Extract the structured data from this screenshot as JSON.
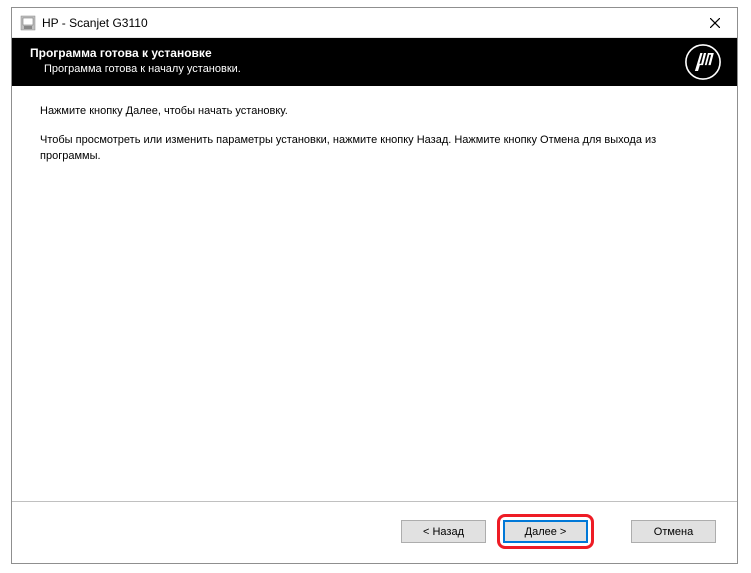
{
  "window": {
    "title": "HP - Scanjet G3110"
  },
  "header": {
    "title": "Программа готова к установке",
    "subtitle": "Программа готова к началу установки."
  },
  "content": {
    "line1": "Нажмите кнопку Далее, чтобы начать установку.",
    "line2": "Чтобы просмотреть или изменить параметры установки, нажмите кнопку Назад. Нажмите кнопку Отмена для выхода из программы."
  },
  "buttons": {
    "back": "< Назад",
    "next": "Далее >",
    "cancel": "Отмена"
  },
  "colors": {
    "highlight": "#ee1c25",
    "defaultBorder": "#0078d7"
  }
}
